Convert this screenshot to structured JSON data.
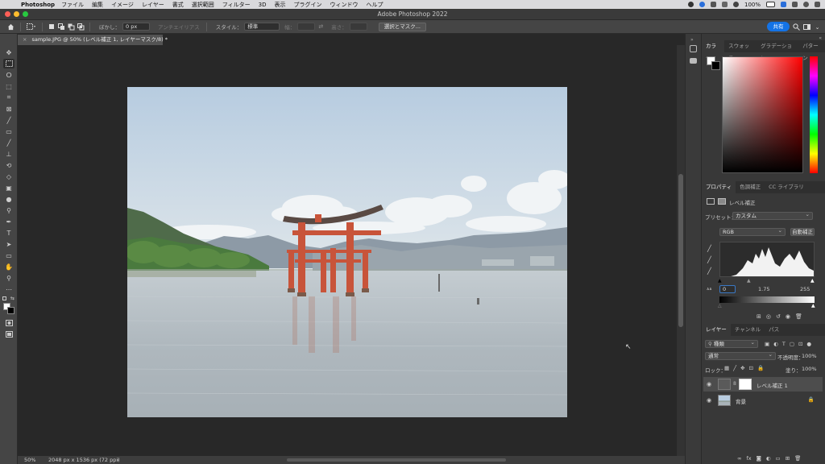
{
  "menubar": {
    "app_name": "Photoshop",
    "items": [
      "ファイル",
      "編集",
      "イメージ",
      "レイヤー",
      "書式",
      "選択範囲",
      "フィルター",
      "3D",
      "表示",
      "プラグイン",
      "ウィンドウ",
      "ヘルプ"
    ],
    "battery": "100%",
    "clock": "☰"
  },
  "window": {
    "title": "Adobe Photoshop 2022"
  },
  "options": {
    "feather_label": "ぼかし：",
    "feather_value": "0 px",
    "antialias_label": "アンチエイリアス",
    "style_label": "スタイル：",
    "style_value": "標準",
    "width_label": "幅：",
    "height_label": "高さ：",
    "select_mask_label": "選択とマスク...",
    "share_label": "共有"
  },
  "document": {
    "tab_label": "sample.JPG @ 50% (レベル補正 1, レイヤーマスク/8) *",
    "zoom": "50%",
    "info": "2048 px x 1536 px (72 ppi)"
  },
  "color_panel": {
    "tabs": [
      "カラー",
      "スウォッチ",
      "グラデーション",
      "パターン"
    ]
  },
  "properties_panel": {
    "tabs": [
      "プロパティ",
      "色調補正",
      "CC ライブラリ"
    ],
    "adjustment_name": "レベル補正",
    "preset_label": "プリセット：",
    "preset_value": "カスタム",
    "channel_value": "RGB",
    "auto_label": "自動補正",
    "input_black": "0",
    "input_mid": "1.75",
    "input_white": "255"
  },
  "layers_panel": {
    "tabs": [
      "レイヤー",
      "チャンネル",
      "パス"
    ],
    "filter_kind": "種類",
    "blend_mode": "通常",
    "opacity_label": "不透明度：",
    "opacity_value": "100%",
    "lock_label": "ロック：",
    "fill_label": "塗り：",
    "fill_value": "100%",
    "layers": [
      {
        "name": "レベル補正 1"
      },
      {
        "name": "背景"
      }
    ]
  },
  "colors": {
    "accent": "#1473e6",
    "torii": "#c8543a"
  }
}
